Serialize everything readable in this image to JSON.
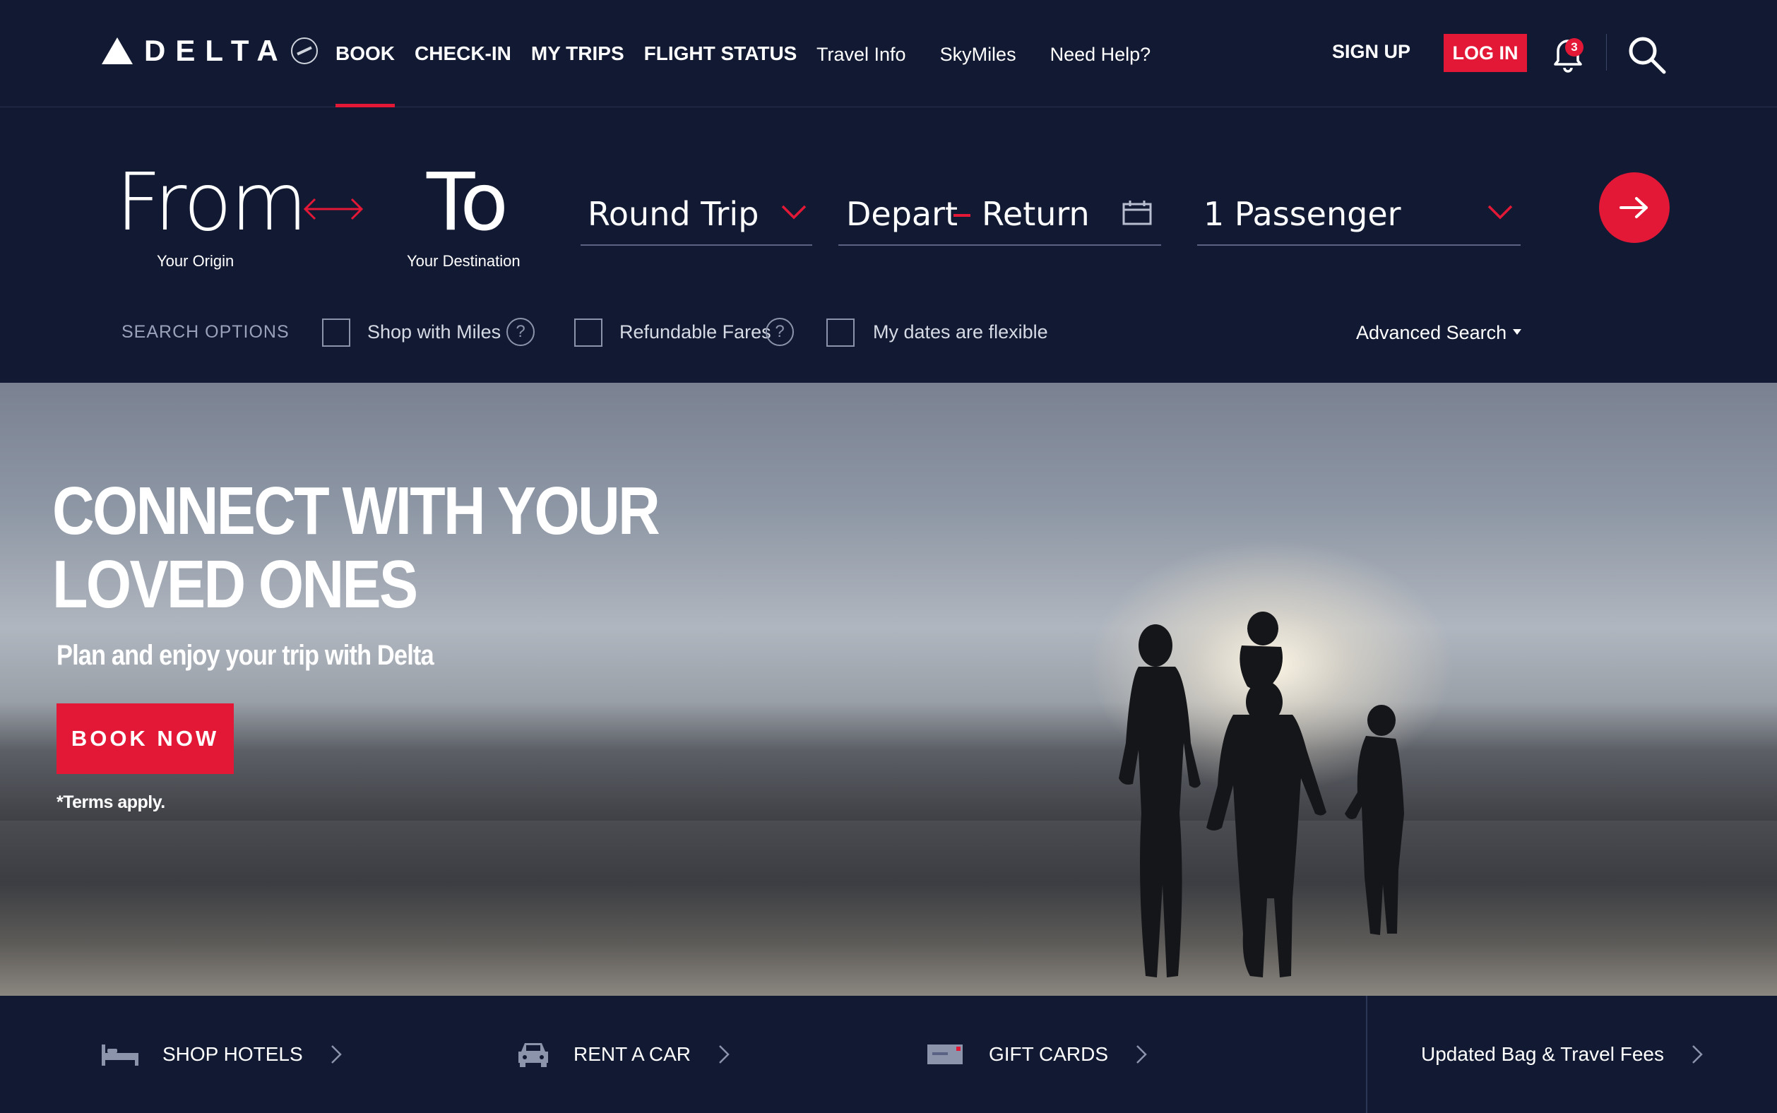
{
  "brand": {
    "name": "DELTA"
  },
  "nav": {
    "main": [
      "BOOK",
      "CHECK-IN",
      "MY TRIPS",
      "FLIGHT STATUS"
    ],
    "secondary": [
      "Travel Info",
      "SkyMiles",
      "Need Help?"
    ],
    "sign_up": "SIGN UP",
    "log_in": "LOG IN",
    "notification_count": "3"
  },
  "booking": {
    "from": "From",
    "from_sub": "Your Origin",
    "to": "To",
    "to_sub": "Your Destination",
    "trip_type": "Round Trip",
    "depart": "Depart",
    "return": "Return",
    "passengers": "1 Passenger",
    "search_options_label": "SEARCH OPTIONS",
    "options": [
      "Shop with Miles",
      "Refundable Fares",
      "My dates are flexible"
    ],
    "advanced_search": "Advanced Search"
  },
  "hero": {
    "headline_line1": "CONNECT WITH YOUR",
    "headline_line2": "LOVED ONES",
    "subheadline": "Plan and enjoy your trip with Delta",
    "cta": "BOOK NOW",
    "terms": "*Terms apply."
  },
  "bottom": {
    "items": [
      "SHOP HOTELS",
      "RENT A CAR",
      "GIFT CARDS"
    ],
    "fees": "Updated Bag & Travel Fees"
  },
  "colors": {
    "accent": "#e31837",
    "navy": "#121a33"
  }
}
